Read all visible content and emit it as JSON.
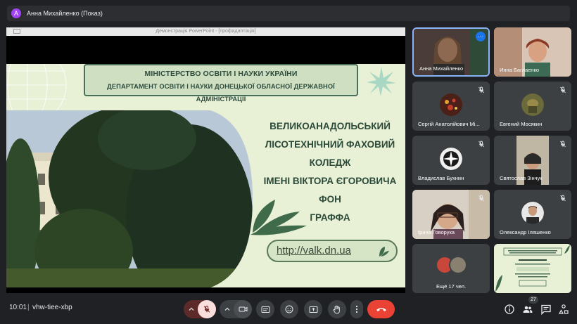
{
  "presenter_bar": {
    "avatar_letter": "А",
    "text": "Анна Михайленко (Показ)"
  },
  "presentation": {
    "window_title": "Демонстрація PowerPoint - [профадаптація]",
    "slide": {
      "ministry_line1": "МІНІСТЕРСТВО ОСВІТИ І НАУКИ УКРАЇНИ",
      "ministry_line2": "ДЕПАРТАМЕНТ ОСВІТИ І НАУКИ ДОНЕЦЬКОЇ ОБЛАСНОЇ ДЕРЖАВНОЇ АДМІНІСТРАЦІЇ",
      "college_line1": "ВЕЛИКОАНАДОЛЬСЬКИЙ",
      "college_line2": "ЛІСОТЕХНІЧНИЙ ФАХОВИЙ КОЛЕДЖ",
      "college_line3": "ІМЕНІ ВІКТОРА ЄГОРОВИЧА ФОН",
      "college_line4": "ГРАФФА",
      "url": "http://valk.dn.ua"
    }
  },
  "participants": [
    {
      "name": "Анна Михайленко",
      "muted": false
    },
    {
      "name": "Инна Баглаенко",
      "muted": false
    },
    {
      "name": "Сергій Анатолійович Мі...",
      "muted": true
    },
    {
      "name": "Евгений Мосякин",
      "muted": true
    },
    {
      "name": "Владислав Бухнин",
      "muted": true
    },
    {
      "name": "Святослав Зінчук",
      "muted": true
    },
    {
      "name": "Ірина Говорука",
      "muted": true
    },
    {
      "name": "Олександр Іляшенко",
      "muted": true
    }
  ],
  "others_tile": {
    "label": "Ещё 17 чел."
  },
  "bottom_bar": {
    "time": "10:01",
    "separator": "|",
    "meeting_code": "vhw-tiee-xbp",
    "participant_count": "27"
  },
  "colors": {
    "background": "#202124",
    "tile": "#3c4043",
    "end_call": "#ea4335",
    "mic_off_bg": "#f9dedc",
    "active_border": "#8ab4f8",
    "slide_green": "#2d4b3c"
  }
}
